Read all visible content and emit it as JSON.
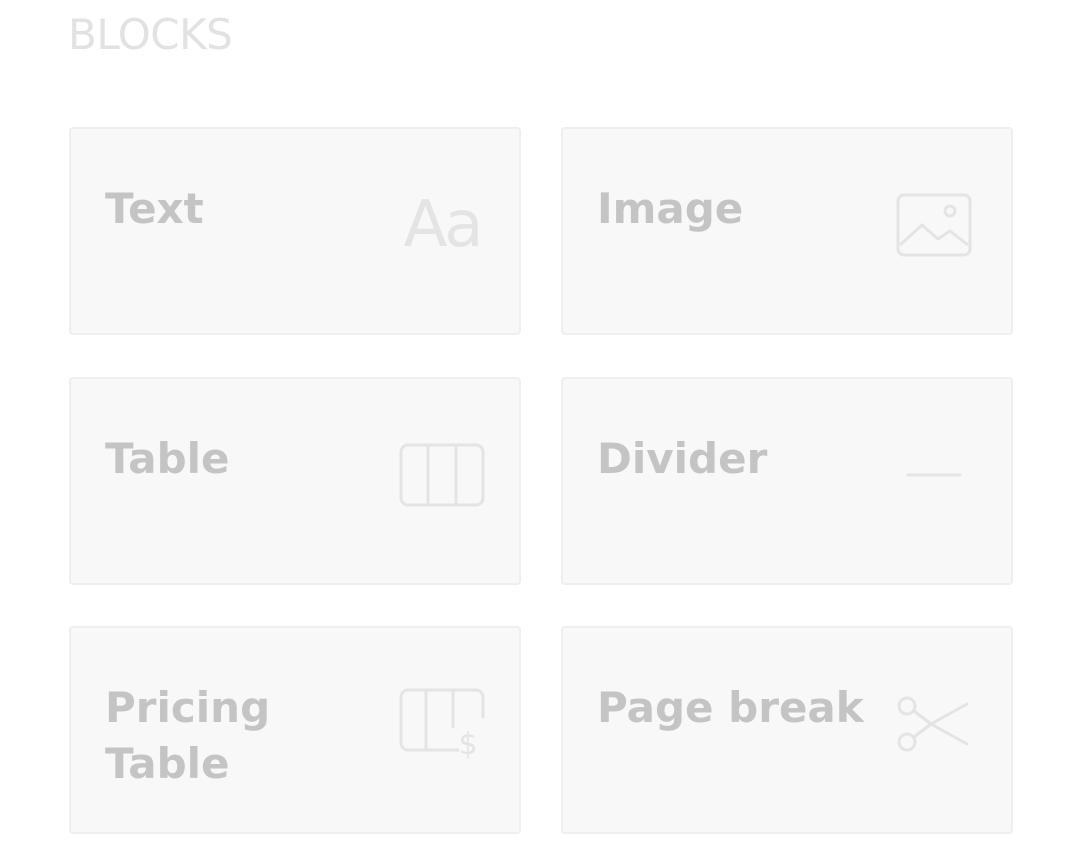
{
  "section": {
    "title": "BLOCKS"
  },
  "blocks": [
    {
      "label": "Text",
      "icon": "text-aa-icon",
      "glyph": "Aa"
    },
    {
      "label": "Image",
      "icon": "image-icon"
    },
    {
      "label": "Table",
      "icon": "table-icon"
    },
    {
      "label": "Divider",
      "icon": "divider-icon"
    },
    {
      "label": "Pricing Table",
      "icon": "pricing-table-icon"
    },
    {
      "label": "Page break",
      "icon": "scissors-icon"
    }
  ],
  "colors": {
    "title": "#e2e2e2",
    "label": "#c4c4c4",
    "icon": "#e4e4e4",
    "tile_background": "#f8f8f8",
    "tile_border": "#efefef"
  }
}
